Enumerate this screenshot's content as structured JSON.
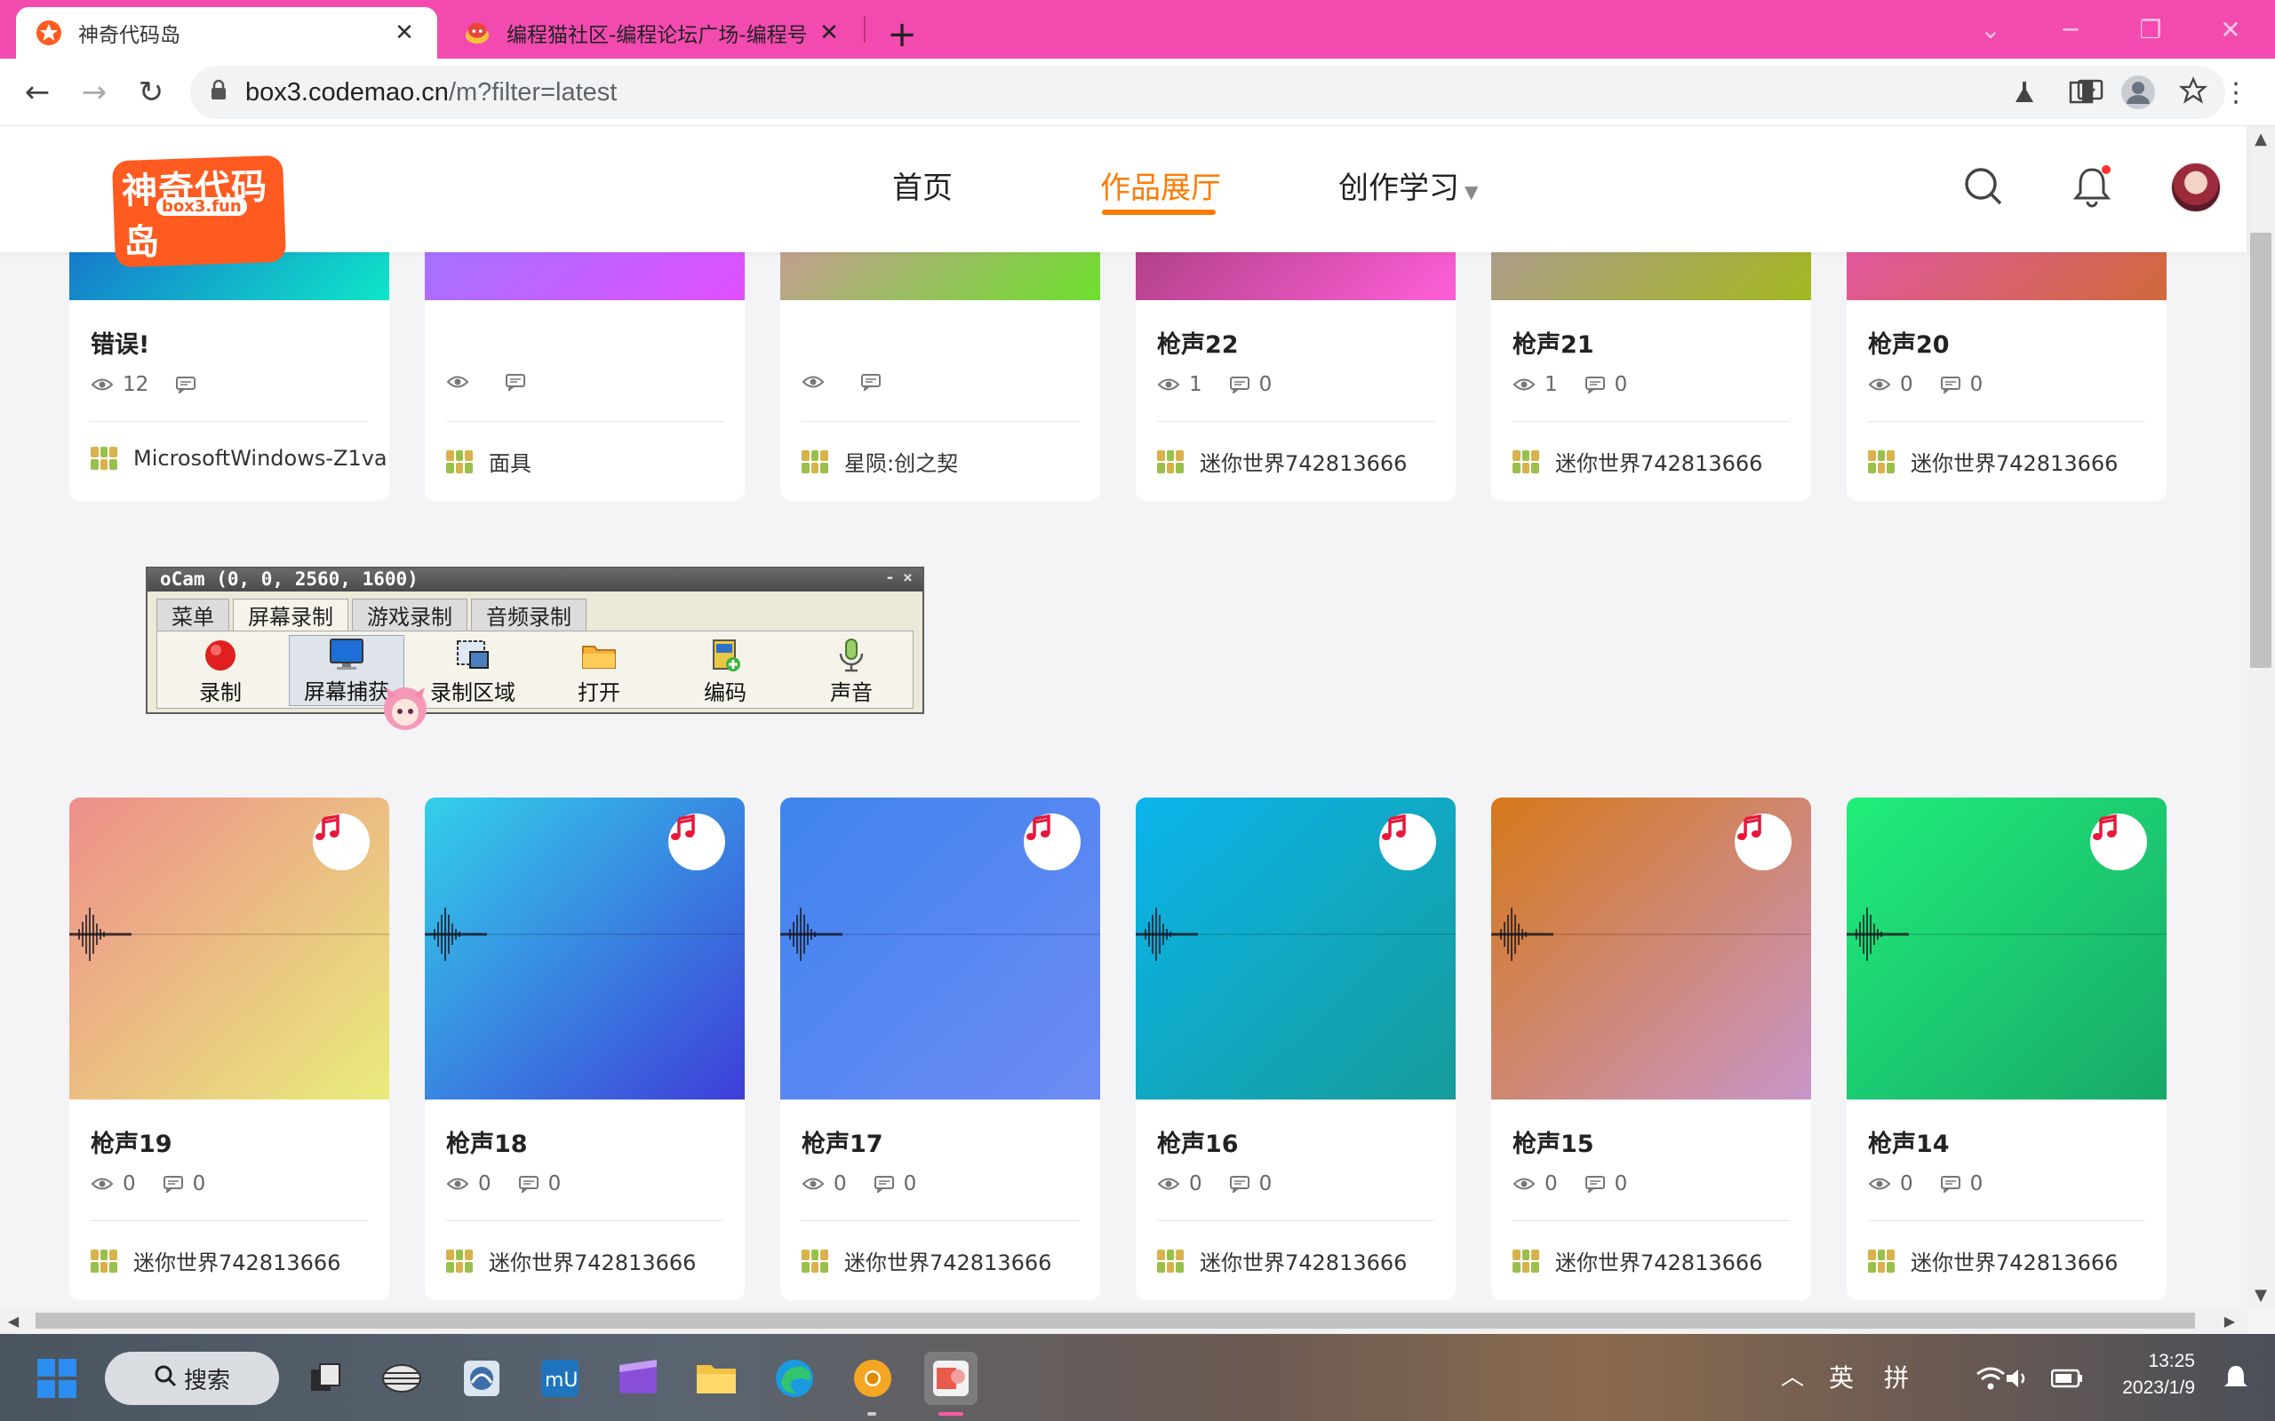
{
  "browser": {
    "tabs": [
      {
        "title": "神奇代码岛",
        "active": true,
        "icon": "star-logo-icon"
      },
      {
        "title": "编程猫社区-编程论坛广场-编程号",
        "active": false,
        "icon": "codemao-icon"
      }
    ],
    "url_host": "box3.codemao.cn",
    "url_path": "/m?filter=latest"
  },
  "site": {
    "logo_main": "神奇代码岛",
    "logo_sub": "box3.fun",
    "nav": {
      "home": "首页",
      "gallery": "作品展厅",
      "learn": "创作学习"
    }
  },
  "cards": [
    {
      "title": "错误!",
      "views": "12",
      "comments": "",
      "author": "MicrosoftWindows-Z1va",
      "gradient": [
        "#1b2bd0",
        "#0fe6c8"
      ],
      "wave": "loud"
    },
    {
      "title": "",
      "views": "",
      "comments": "",
      "author": "面具",
      "gradient": [
        "#7a8cff",
        "#e04fff"
      ],
      "wave": "thin"
    },
    {
      "title": "",
      "views": "",
      "comments": "",
      "author": "星陨:创之契",
      "gradient": [
        "#ff6fd6",
        "#6ee02e"
      ],
      "wave": "loud"
    },
    {
      "title": "枪声22",
      "views": "1",
      "comments": "0",
      "author": "迷你世界742813666",
      "gradient": [
        "#7a2c50",
        "#ff5fd8"
      ],
      "wave": "blip"
    },
    {
      "title": "枪声21",
      "views": "1",
      "comments": "0",
      "author": "迷你世界742813666",
      "gradient": [
        "#b58ad8",
        "#a3b820"
      ],
      "wave": "blip"
    },
    {
      "title": "枪声20",
      "views": "0",
      "comments": "0",
      "author": "迷你世界742813666",
      "gradient": [
        "#f04ae8",
        "#cf6a3a"
      ],
      "wave": "blip"
    },
    {
      "title": "枪声19",
      "views": "0",
      "comments": "0",
      "author": "迷你世界742813666",
      "gradient": [
        "#ee8e8a",
        "#e8ec7c"
      ],
      "wave": "blip"
    },
    {
      "title": "枪声18",
      "views": "0",
      "comments": "0",
      "author": "迷你世界742813666",
      "gradient": [
        "#33d0ea",
        "#3e3ed8"
      ],
      "wave": "blip"
    },
    {
      "title": "枪声17",
      "views": "0",
      "comments": "0",
      "author": "迷你世界742813666",
      "gradient": [
        "#3e84ee",
        "#6e8af4"
      ],
      "wave": "blip"
    },
    {
      "title": "枪声16",
      "views": "0",
      "comments": "0",
      "author": "迷你世界742813666",
      "gradient": [
        "#0bb4ec",
        "#169c9a"
      ],
      "wave": "blip"
    },
    {
      "title": "枪声15",
      "views": "0",
      "comments": "0",
      "author": "迷你世界742813666",
      "gradient": [
        "#d6781a",
        "#c896c8"
      ],
      "wave": "blip"
    },
    {
      "title": "枪声14",
      "views": "0",
      "comments": "0",
      "author": "迷你世界742813666",
      "gradient": [
        "#20ee7a",
        "#18a868"
      ],
      "wave": "blip"
    }
  ],
  "ocam": {
    "title": "oCam (0, 0, 2560, 1600)",
    "tabs": [
      "菜单",
      "屏幕录制",
      "游戏录制",
      "音频录制"
    ],
    "selected_tab": "屏幕录制",
    "buttons": [
      "录制",
      "屏幕捕获",
      "录制区域",
      "打开",
      "编码",
      "声音"
    ],
    "selected_button": "屏幕捕获"
  },
  "taskbar": {
    "search_label": "搜索",
    "ime_lang": "英",
    "ime_mode": "拼",
    "time": "13:25",
    "date": "2023/1/9"
  },
  "colors": {
    "tabstrip": "#f24aaf",
    "accent": "#ff7a00",
    "music_badge": "#e8173a"
  }
}
